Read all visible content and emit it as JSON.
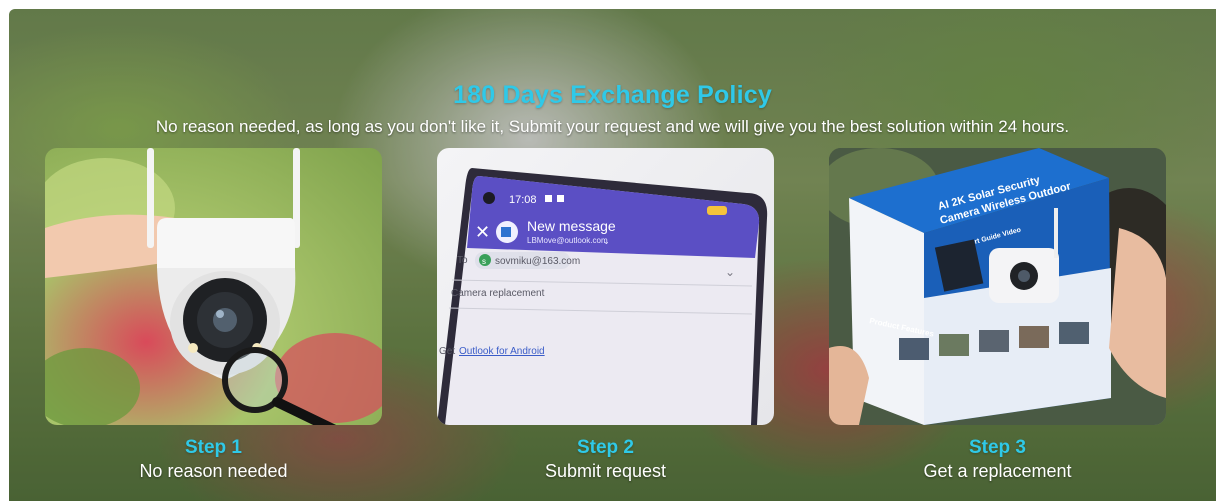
{
  "header": {
    "title": "180 Days Exchange Policy",
    "subtitle": "No reason needed, as long as you don't like it, Submit your request and we will give you the best solution within 24 hours."
  },
  "steps": [
    {
      "label": "Step 1",
      "description": "No reason needed"
    },
    {
      "label": "Step 2",
      "description": "Submit request"
    },
    {
      "label": "Step 3",
      "description": "Get a replacement"
    }
  ],
  "phone": {
    "time": "17:08",
    "compose_title": "New message",
    "from_address": "LBMove@outlook.com",
    "to_label": "To",
    "to_recipient": "sovmiku@163.com",
    "subject": "Camera replacement",
    "footer_prefix": "Get",
    "footer_link": "Outlook for Android"
  },
  "box": {
    "headline_1": "AI 2K Solar Security",
    "headline_2": "Camera Wireless Outdoor",
    "support_label": "Get Support Guide Video",
    "features_label": "Product Features"
  },
  "colors": {
    "accent": "#2fc9e8",
    "text_light": "#ffffff",
    "phone_header": "#5b4fc4"
  }
}
